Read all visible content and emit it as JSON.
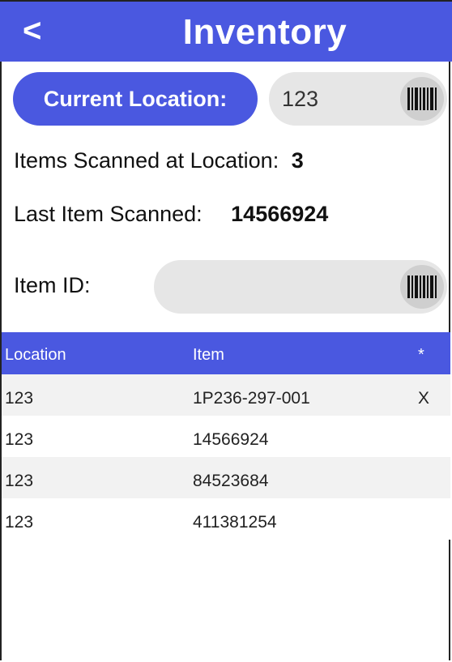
{
  "header": {
    "back_label": "<",
    "title": "Inventory"
  },
  "location": {
    "button_label": "Current Location:",
    "value": "123",
    "scan_icon": "barcode-icon"
  },
  "stats": {
    "items_scanned_label": "Items Scanned at Location:",
    "items_scanned_value": "3",
    "last_item_label": "Last Item Scanned:",
    "last_item_value": "14566924"
  },
  "item_id": {
    "label": "Item ID:",
    "value": "",
    "scan_icon": "barcode-icon"
  },
  "table": {
    "columns": [
      "Location",
      "Item",
      "*"
    ],
    "rows": [
      {
        "location": "123",
        "item": "1P236-297-001",
        "flag": "X"
      },
      {
        "location": "123",
        "item": "14566924",
        "flag": ""
      },
      {
        "location": "123",
        "item": "84523684",
        "flag": ""
      },
      {
        "location": "123",
        "item": "411381254",
        "flag": ""
      }
    ]
  },
  "colors": {
    "accent": "#4a58e0",
    "input_bg": "#e6e6e6",
    "row_alt": "#f2f2f2"
  }
}
